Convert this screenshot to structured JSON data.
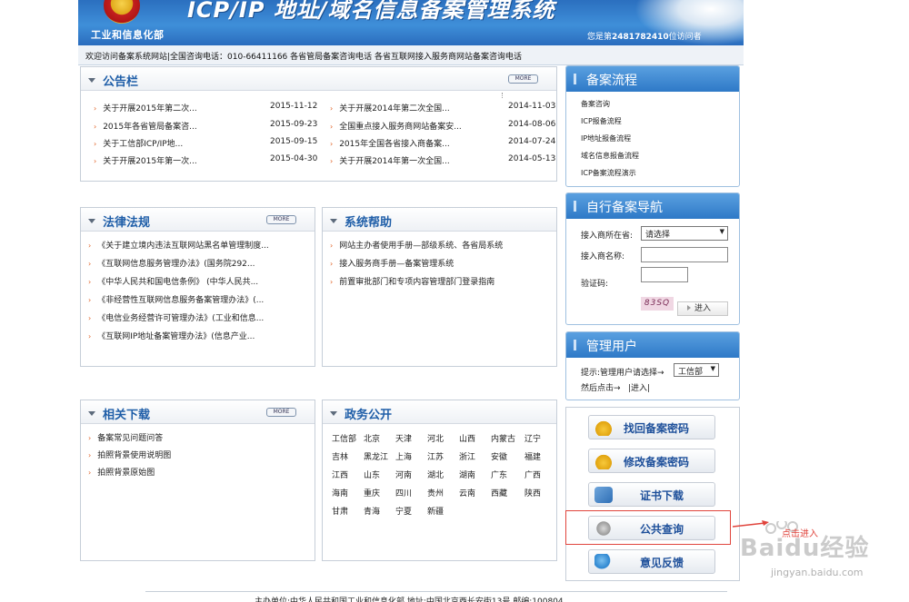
{
  "header": {
    "ministry": "工业和信息化部",
    "system_title": "ICP/IP 地址/域名信息备案管理系统",
    "visit_prefix": "您是第",
    "visit_count": "2481782410",
    "visit_suffix": "位访问者"
  },
  "notice_bar": "欢迎访问备案系统网站|全国咨询电话：010-66411166 各省管局备案咨询电话 各省互联网接入服务商网站备案咨询电话",
  "announcements": {
    "title": "公告栏",
    "more": "MORE",
    "left": [
      {
        "text": "关于开展2015年第二次...",
        "date": "2015-11-12"
      },
      {
        "text": "2015年各省管局备案咨...",
        "date": "2015-09-23"
      },
      {
        "text": "关于工信部ICP/IP地...",
        "date": "2015-09-15"
      },
      {
        "text": "关于开展2015年第一次...",
        "date": "2015-04-30"
      }
    ],
    "right": [
      {
        "text": "关于开展2014年第二次全国...",
        "date": "2014-11-03"
      },
      {
        "text": "全国重点接入服务商网站备案安...",
        "date": "2014-08-06"
      },
      {
        "text": "2015年全国各省接入商备案...",
        "date": "2014-07-24"
      },
      {
        "text": "关于开展2014年第一次全国...",
        "date": "2014-05-13"
      }
    ]
  },
  "laws": {
    "title": "法律法规",
    "more": "MORE",
    "items": [
      "《关于建立境内违法互联网站黑名单管理制度...",
      "《互联网信息服务管理办法》(国务院292...",
      "《中华人民共和国电信条例》 (中华人民共...",
      "《非经营性互联网信息服务备案管理办法》(...",
      "《电信业务经营许可管理办法》(工业和信息...",
      "《互联网IP地址备案管理办法》(信息产业..."
    ]
  },
  "help": {
    "title": "系统帮助",
    "items": [
      "网站主办者使用手册—部级系统、各省局系统",
      "接入服务商手册—备案管理系统",
      "前置审批部门和专项内容管理部门登录指南"
    ]
  },
  "downloads": {
    "title": "相关下载",
    "more": "MORE",
    "items": [
      "备案常见问题问答",
      "拍照背景使用说明图",
      "拍照背景原始图"
    ]
  },
  "gov": {
    "title": "政务公开",
    "provinces": [
      [
        "工信部",
        "北京",
        "天津",
        "河北",
        "山西",
        "内蒙古",
        "辽宁"
      ],
      [
        "吉林",
        "黑龙江",
        "上海",
        "江苏",
        "浙江",
        "安徽",
        "福建"
      ],
      [
        "江西",
        "山东",
        "河南",
        "湖北",
        "湖南",
        "广东",
        "广西"
      ],
      [
        "海南",
        "重庆",
        "四川",
        "贵州",
        "云南",
        "西藏",
        "陕西"
      ],
      [
        "甘肃",
        "青海",
        "宁夏",
        "新疆"
      ]
    ]
  },
  "process": {
    "title": "备案流程",
    "items": [
      "备案咨询",
      "ICP报备流程",
      "IP地址报备流程",
      "域名信息报备流程",
      "ICP备案流程演示"
    ]
  },
  "nav": {
    "title": "自行备案导航",
    "province_label": "接入商所在省:",
    "province_value": "请选择",
    "name_label": "接入商名称:",
    "captcha_label": "验证码:",
    "captcha_text": "83SQ",
    "enter": "进入"
  },
  "admin": {
    "title": "管理用户",
    "hint_label": "提示:管理用户请选择→",
    "select_value": "工信部",
    "then_label": "然后点击→",
    "enter": "|进入|"
  },
  "actions": {
    "find_password": "找回备案密码",
    "change_password": "修改备案密码",
    "cert_download": "证书下载",
    "public_query": "公共查询",
    "feedback": "意见反馈"
  },
  "annotation": {
    "hint": "点击进入"
  },
  "watermark": {
    "logo": "Baidu经验",
    "url": "jingyan.baidu.com"
  },
  "footer": "主办单位:中华人民共和国工业和信息化部 地址:中国北京西长安街13号 邮编:100804"
}
